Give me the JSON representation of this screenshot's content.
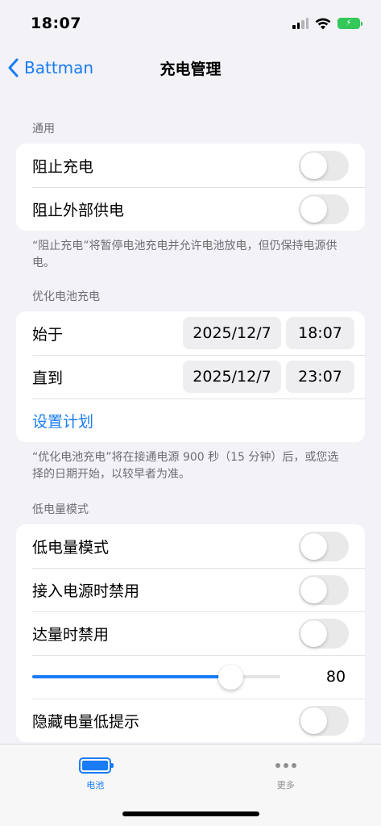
{
  "status_bar": {
    "time": "18:07",
    "icons": [
      "cellular-signal-icon",
      "wifi-icon",
      "battery-charging-icon"
    ],
    "battery_color": "#34c759"
  },
  "nav": {
    "back_label": "Battman",
    "title": "充电管理"
  },
  "sections": {
    "general": {
      "header": "通用",
      "rows": [
        {
          "label": "阻止充电",
          "toggle_on": false
        },
        {
          "label": "阻止外部供电",
          "toggle_on": false
        }
      ],
      "footer": "“阻止充电”将暂停电池充电并允许电池放电，但仍保持电源供电。"
    },
    "optimized": {
      "header": "优化电池充电",
      "start": {
        "label": "始于",
        "date": "2025/12/7",
        "time": "18:07"
      },
      "end": {
        "label": "直到",
        "date": "2025/12/7",
        "time": "23:07"
      },
      "schedule_link": "设置计划",
      "footer": "“优化电池充电”将在接通电源 900 秒（15 分钟）后，或您选择的日期开始，以较早者为准。"
    },
    "low_power": {
      "header": "低电量模式",
      "rows": [
        {
          "label": "低电量模式",
          "toggle_on": false
        },
        {
          "label": "接入电源时禁用",
          "toggle_on": false
        },
        {
          "label": "达量时禁用",
          "toggle_on": false
        }
      ],
      "slider": {
        "value": "80",
        "fraction": 0.8
      },
      "hide_alert": {
        "label": "隐藏电量低提示",
        "toggle_on": false
      }
    }
  },
  "tab_bar": {
    "tabs": [
      {
        "label": "电池",
        "icon": "battery-icon",
        "active": true
      },
      {
        "label": "更多",
        "icon": "more-icon",
        "active": false
      }
    ]
  },
  "colors": {
    "accent": "#1a7cf5",
    "background": "#f2f2f7",
    "secondary_text": "#6d6d72"
  }
}
